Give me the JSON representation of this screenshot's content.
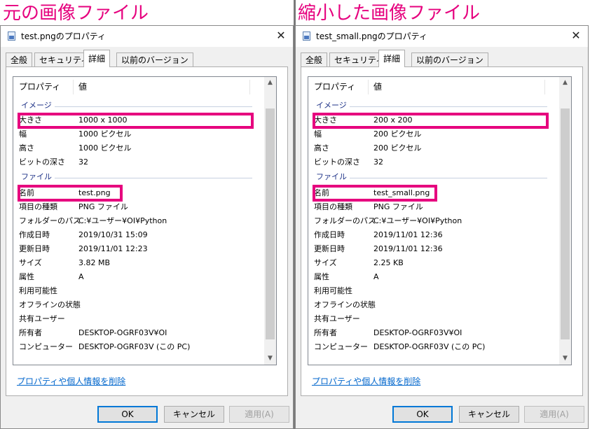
{
  "colors": {
    "highlight": "#e6007e",
    "link": "#0066cc",
    "group_text": "#1e3287"
  },
  "panels": [
    {
      "heading": "元の画像ファイル",
      "window_title": "test.pngのプロパティ",
      "tabs": [
        "全般",
        "セキュリティ",
        "詳細",
        "以前のバージョン"
      ],
      "active_tab": "詳細",
      "header": {
        "property": "プロパティ",
        "value": "値"
      },
      "group_image": "イメージ",
      "group_file": "ファイル",
      "rows": {
        "size": {
          "name": "大きさ",
          "value": "1000 x 1000"
        },
        "width": {
          "name": "幅",
          "value": "1000 ピクセル"
        },
        "height": {
          "name": "高さ",
          "value": "1000 ピクセル"
        },
        "bitdepth": {
          "name": "ビットの深さ",
          "value": "32"
        },
        "filename": {
          "name": "名前",
          "value": "test.png"
        },
        "itemtype": {
          "name": "項目の種類",
          "value": "PNG ファイル"
        },
        "folder": {
          "name": "フォルダーのパス",
          "value": "C:¥ユーザー¥OI¥Python"
        },
        "created": {
          "name": "作成日時",
          "value": "2019/10/31 15:09"
        },
        "modified": {
          "name": "更新日時",
          "value": "2019/11/01 12:23"
        },
        "filesize": {
          "name": "サイズ",
          "value": "3.82 MB"
        },
        "attributes": {
          "name": "属性",
          "value": "A"
        },
        "availability": {
          "name": "利用可能性",
          "value": ""
        },
        "offline": {
          "name": "オフラインの状態",
          "value": ""
        },
        "shared": {
          "name": "共有ユーザー",
          "value": ""
        },
        "owner": {
          "name": "所有者",
          "value": "DESKTOP-OGRF03V¥OI"
        },
        "computer": {
          "name": "コンピューター",
          "value": "DESKTOP-OGRF03V (この PC)"
        }
      },
      "remove_link": "プロパティや個人情報を削除",
      "buttons": {
        "ok": "OK",
        "cancel": "キャンセル",
        "apply": "適用(A)"
      }
    },
    {
      "heading": "縮小した画像ファイル",
      "window_title": "test_small.pngのプロパティ",
      "tabs": [
        "全般",
        "セキュリティ",
        "詳細",
        "以前のバージョン"
      ],
      "active_tab": "詳細",
      "header": {
        "property": "プロパティ",
        "value": "値"
      },
      "group_image": "イメージ",
      "group_file": "ファイル",
      "rows": {
        "size": {
          "name": "大きさ",
          "value": "200 x 200"
        },
        "width": {
          "name": "幅",
          "value": "200 ピクセル"
        },
        "height": {
          "name": "高さ",
          "value": "200 ピクセル"
        },
        "bitdepth": {
          "name": "ビットの深さ",
          "value": "32"
        },
        "filename": {
          "name": "名前",
          "value": "test_small.png"
        },
        "itemtype": {
          "name": "項目の種類",
          "value": "PNG ファイル"
        },
        "folder": {
          "name": "フォルダーのパス",
          "value": "C:¥ユーザー¥OI¥Python"
        },
        "created": {
          "name": "作成日時",
          "value": "2019/11/01 12:36"
        },
        "modified": {
          "name": "更新日時",
          "value": "2019/11/01 12:36"
        },
        "filesize": {
          "name": "サイズ",
          "value": "2.25 KB"
        },
        "attributes": {
          "name": "属性",
          "value": "A"
        },
        "availability": {
          "name": "利用可能性",
          "value": ""
        },
        "offline": {
          "name": "オフラインの状態",
          "value": ""
        },
        "shared": {
          "name": "共有ユーザー",
          "value": ""
        },
        "owner": {
          "name": "所有者",
          "value": "DESKTOP-OGRF03V¥OI"
        },
        "computer": {
          "name": "コンピューター",
          "value": "DESKTOP-OGRF03V (この PC)"
        }
      },
      "remove_link": "プロパティや個人情報を削除",
      "buttons": {
        "ok": "OK",
        "cancel": "キャンセル",
        "apply": "適用(A)"
      }
    }
  ]
}
